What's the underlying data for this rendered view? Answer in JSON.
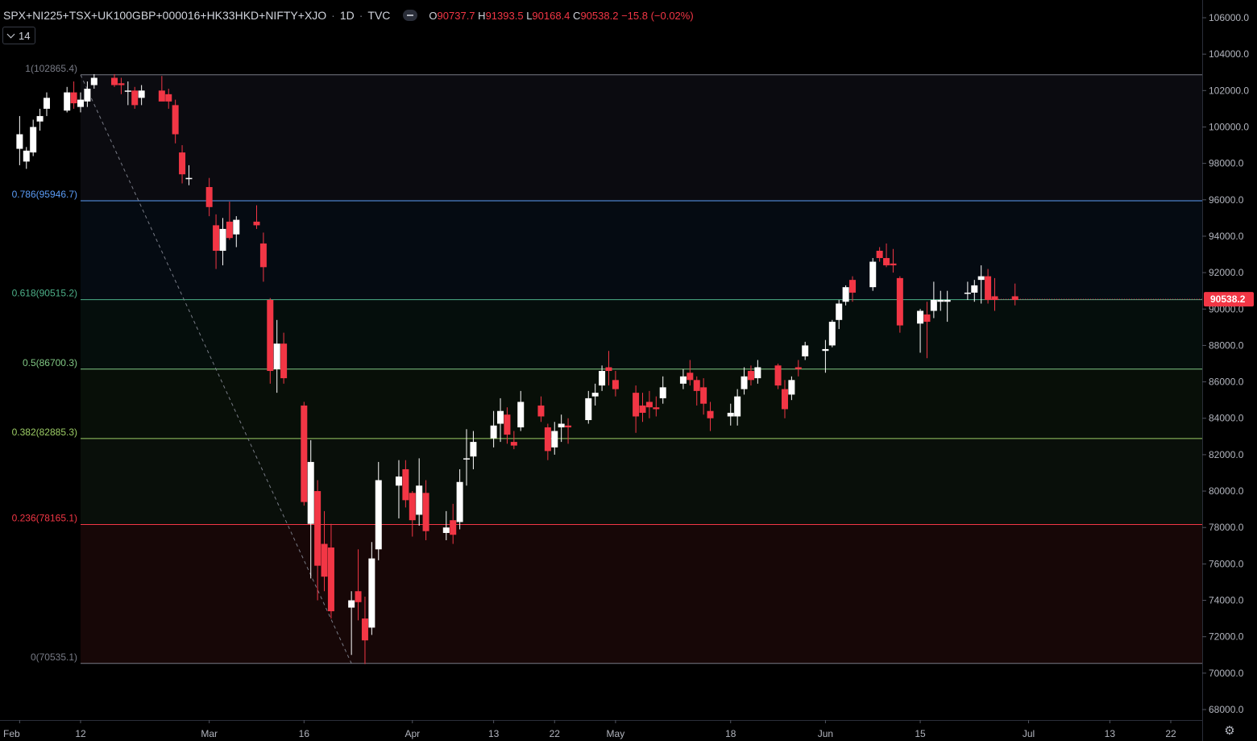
{
  "header": {
    "symbol": "SPX+NI225+TSX+UK100GBP+000016+HK33HKD+NIFTY+XJO",
    "interval": "1D",
    "source": "TVC",
    "o_label": "O",
    "o_value": "90737.7",
    "h_label": "H",
    "h_value": "91393.5",
    "l_label": "L",
    "l_value": "90168.4",
    "c_label": "C",
    "c_value": "90538.2",
    "change": "−15.8 (−0.02%)"
  },
  "indicator": {
    "value": "14"
  },
  "colors": {
    "background": "#000000",
    "up": "#ffffff",
    "down": "#f23645",
    "axis_text": "#b2b5be",
    "price_tag": "#f23645"
  },
  "icons": {
    "collapse": "chevron-down-icon",
    "hide": "minus-icon",
    "settings": "gear-icon"
  },
  "chart_data": {
    "type": "candlestick",
    "title": "SPX+NI225+TSX+UK100GBP+000016+HK33HKD+NIFTY+XJO · 1D · TVC",
    "ylim": [
      67500,
      107000
    ],
    "y_ticks": [
      106000,
      104000,
      102000,
      100000,
      98000,
      96000,
      94000,
      92000,
      90000,
      88000,
      86000,
      84000,
      82000,
      80000,
      78000,
      76000,
      74000,
      72000,
      70000,
      68000
    ],
    "y_tick_labels": [
      "106000.0",
      "104000.0",
      "102000.0",
      "100000.0",
      "98000.0",
      "96000.0",
      "94000.0",
      "92000.0",
      "90000.0",
      "88000.0",
      "86000.0",
      "84000.0",
      "82000.0",
      "80000.0",
      "78000.0",
      "76000.0",
      "74000.0",
      "72000.0",
      "70000.0",
      "68000.0"
    ],
    "x_ticks": [
      "2020-02-03",
      "2020-02-12",
      "2020-03-02",
      "2020-03-16",
      "2020-04-01",
      "2020-04-13",
      "2020-04-22",
      "2020-05-01",
      "2020-05-18",
      "2020-06-01",
      "2020-06-15",
      "2020-07-01",
      "2020-07-13",
      "2020-07-22"
    ],
    "x_tick_labels": [
      "Feb",
      "12",
      "Mar",
      "16",
      "Apr",
      "13",
      "22",
      "May",
      "18",
      "Jun",
      "15",
      "Jul",
      "13",
      "22"
    ],
    "last_price": 90538.2,
    "last_price_label": "90538.2",
    "fib": {
      "levels": [
        {
          "ratio": "1",
          "price": 102865.4,
          "label": "1(102865.4)",
          "color": "#787b86"
        },
        {
          "ratio": "0.786",
          "price": 95946.7,
          "label": "0.786(95946.7)",
          "color": "#5b9cf6"
        },
        {
          "ratio": "0.618",
          "price": 90515.2,
          "label": "0.618(90515.2)",
          "color": "#4caf88"
        },
        {
          "ratio": "0.5",
          "price": 86700.3,
          "label": "0.5(86700.3)",
          "color": "#81c784"
        },
        {
          "ratio": "0.382",
          "price": 82885.3,
          "label": "0.382(82885.3)",
          "color": "#9ccc65"
        },
        {
          "ratio": "0.236",
          "price": 78165.1,
          "label": "0.236(78165.1)",
          "color": "#f23645"
        },
        {
          "ratio": "0",
          "price": 70535.1,
          "label": "0(70535.1)",
          "color": "#787b86"
        }
      ],
      "fills": [
        "#0b0b10",
        "#050b12",
        "#050e0c",
        "#080f08",
        "#090f0a",
        "#170707"
      ],
      "trend_from": {
        "date": "2020-02-12",
        "price": 102865.4
      },
      "trend_to": {
        "date": "2020-03-23",
        "price": 70535.1
      }
    },
    "candles": [
      {
        "d": "2020-02-03",
        "o": 98800,
        "h": 100600,
        "l": 97900,
        "c": 99600
      },
      {
        "d": "2020-02-04",
        "o": 98100,
        "h": 98900,
        "l": 97700,
        "c": 98700
      },
      {
        "d": "2020-02-05",
        "o": 98600,
        "h": 100400,
        "l": 98400,
        "c": 100000
      },
      {
        "d": "2020-02-06",
        "o": 100300,
        "h": 101000,
        "l": 99800,
        "c": 100600
      },
      {
        "d": "2020-02-07",
        "o": 101000,
        "h": 101900,
        "l": 100600,
        "c": 101600
      },
      {
        "d": "2020-02-10",
        "o": 100900,
        "h": 102200,
        "l": 100800,
        "c": 101900
      },
      {
        "d": "2020-02-11",
        "o": 101900,
        "h": 102500,
        "l": 101000,
        "c": 101300
      },
      {
        "d": "2020-02-12",
        "o": 101100,
        "h": 101900,
        "l": 100800,
        "c": 101500
      },
      {
        "d": "2020-02-13",
        "o": 101400,
        "h": 102500,
        "l": 101100,
        "c": 102100
      },
      {
        "d": "2020-02-14",
        "o": 102300,
        "h": 102900,
        "l": 102100,
        "c": 102700
      },
      {
        "d": "2020-02-17",
        "o": 102700,
        "h": 102900,
        "l": 102200,
        "c": 102300
      },
      {
        "d": "2020-02-18",
        "o": 102400,
        "h": 102700,
        "l": 101800,
        "c": 102300
      },
      {
        "d": "2020-02-19",
        "o": 102000,
        "h": 102500,
        "l": 101200,
        "c": 102000
      },
      {
        "d": "2020-02-20",
        "o": 102000,
        "h": 102200,
        "l": 101000,
        "c": 101200
      },
      {
        "d": "2020-02-21",
        "o": 101600,
        "h": 102300,
        "l": 101200,
        "c": 102000
      },
      {
        "d": "2020-02-24",
        "o": 102000,
        "h": 102800,
        "l": 101500,
        "c": 101400
      },
      {
        "d": "2020-02-25",
        "o": 101800,
        "h": 102100,
        "l": 101000,
        "c": 101400
      },
      {
        "d": "2020-02-26",
        "o": 101200,
        "h": 101500,
        "l": 99100,
        "c": 99600
      },
      {
        "d": "2020-02-27",
        "o": 98600,
        "h": 99000,
        "l": 96900,
        "c": 97400
      },
      {
        "d": "2020-02-28",
        "o": 97200,
        "h": 97900,
        "l": 96800,
        "c": 97200
      },
      {
        "d": "2020-03-02",
        "o": 96700,
        "h": 97200,
        "l": 95100,
        "c": 95600
      },
      {
        "d": "2020-03-03",
        "o": 94600,
        "h": 95200,
        "l": 92200,
        "c": 93200
      },
      {
        "d": "2020-03-04",
        "o": 93200,
        "h": 95000,
        "l": 92400,
        "c": 94400
      },
      {
        "d": "2020-03-05",
        "o": 94800,
        "h": 95900,
        "l": 93800,
        "c": 93900
      },
      {
        "d": "2020-03-06",
        "o": 94100,
        "h": 95100,
        "l": 93400,
        "c": 94900
      },
      {
        "d": "2020-03-09",
        "o": 94800,
        "h": 95700,
        "l": 94400,
        "c": 94600
      },
      {
        "d": "2020-03-10",
        "o": 93600,
        "h": 94200,
        "l": 91500,
        "c": 92300
      },
      {
        "d": "2020-03-11",
        "o": 90500,
        "h": 90600,
        "l": 85900,
        "c": 86600
      },
      {
        "d": "2020-03-12",
        "o": 86700,
        "h": 89400,
        "l": 85400,
        "c": 88100
      },
      {
        "d": "2020-03-13",
        "o": 88100,
        "h": 88700,
        "l": 85900,
        "c": 86200
      },
      {
        "d": "2020-03-16",
        "o": 84700,
        "h": 84900,
        "l": 79200,
        "c": 79400
      },
      {
        "d": "2020-03-17",
        "o": 78200,
        "h": 82800,
        "l": 75200,
        "c": 81600
      },
      {
        "d": "2020-03-18",
        "o": 80000,
        "h": 80600,
        "l": 74000,
        "c": 75900
      },
      {
        "d": "2020-03-19",
        "o": 77100,
        "h": 78900,
        "l": 74500,
        "c": 75300
      },
      {
        "d": "2020-03-20",
        "o": 76900,
        "h": 78200,
        "l": 73000,
        "c": 73400
      },
      {
        "d": "2020-03-23",
        "o": 73600,
        "h": 74500,
        "l": 71000,
        "c": 74000
      },
      {
        "d": "2020-03-24",
        "o": 74500,
        "h": 76800,
        "l": 72900,
        "c": 73900
      },
      {
        "d": "2020-03-25",
        "o": 73000,
        "h": 74200,
        "l": 70500,
        "c": 71800
      },
      {
        "d": "2020-03-26",
        "o": 72500,
        "h": 77200,
        "l": 72100,
        "c": 76300
      },
      {
        "d": "2020-03-27",
        "o": 76800,
        "h": 81600,
        "l": 76200,
        "c": 80600
      },
      {
        "d": "2020-03-30",
        "o": 80300,
        "h": 81700,
        "l": 78500,
        "c": 80800
      },
      {
        "d": "2020-03-31",
        "o": 81200,
        "h": 81700,
        "l": 79100,
        "c": 79500
      },
      {
        "d": "2020-04-01",
        "o": 79900,
        "h": 80000,
        "l": 77500,
        "c": 78400
      },
      {
        "d": "2020-04-02",
        "o": 78700,
        "h": 81800,
        "l": 78100,
        "c": 80300
      },
      {
        "d": "2020-04-03",
        "o": 79900,
        "h": 80600,
        "l": 77300,
        "c": 77800
      },
      {
        "d": "2020-04-06",
        "o": 77700,
        "h": 78900,
        "l": 77300,
        "c": 78000
      },
      {
        "d": "2020-04-07",
        "o": 78400,
        "h": 79300,
        "l": 77100,
        "c": 77600
      },
      {
        "d": "2020-04-08",
        "o": 78300,
        "h": 81200,
        "l": 77900,
        "c": 80500
      },
      {
        "d": "2020-04-09",
        "o": 81800,
        "h": 83400,
        "l": 80300,
        "c": 81800
      },
      {
        "d": "2020-04-10",
        "o": 81900,
        "h": 83300,
        "l": 81200,
        "c": 82700
      },
      {
        "d": "2020-04-13",
        "o": 82900,
        "h": 84400,
        "l": 82400,
        "c": 83600
      },
      {
        "d": "2020-04-14",
        "o": 83700,
        "h": 85100,
        "l": 82700,
        "c": 84400
      },
      {
        "d": "2020-04-15",
        "o": 84200,
        "h": 84600,
        "l": 82600,
        "c": 83100
      },
      {
        "d": "2020-04-16",
        "o": 82700,
        "h": 83300,
        "l": 82300,
        "c": 82500
      },
      {
        "d": "2020-04-17",
        "o": 83500,
        "h": 85500,
        "l": 83300,
        "c": 84900
      },
      {
        "d": "2020-04-20",
        "o": 84700,
        "h": 85200,
        "l": 83800,
        "c": 84100
      },
      {
        "d": "2020-04-21",
        "o": 83500,
        "h": 83700,
        "l": 81700,
        "c": 82200
      },
      {
        "d": "2020-04-22",
        "o": 82400,
        "h": 83800,
        "l": 82000,
        "c": 83300
      },
      {
        "d": "2020-04-23",
        "o": 83500,
        "h": 84200,
        "l": 82700,
        "c": 83700
      },
      {
        "d": "2020-04-24",
        "o": 83600,
        "h": 84000,
        "l": 82600,
        "c": 83500
      },
      {
        "d": "2020-04-27",
        "o": 83900,
        "h": 85500,
        "l": 83700,
        "c": 85100
      },
      {
        "d": "2020-04-28",
        "o": 85200,
        "h": 85900,
        "l": 84700,
        "c": 85400
      },
      {
        "d": "2020-04-29",
        "o": 85800,
        "h": 86900,
        "l": 85500,
        "c": 86600
      },
      {
        "d": "2020-04-30",
        "o": 86800,
        "h": 87700,
        "l": 85800,
        "c": 86600
      },
      {
        "d": "2020-05-01",
        "o": 86100,
        "h": 86600,
        "l": 85200,
        "c": 85600
      },
      {
        "d": "2020-05-04",
        "o": 85400,
        "h": 85800,
        "l": 83200,
        "c": 84100
      },
      {
        "d": "2020-05-05",
        "o": 84700,
        "h": 85400,
        "l": 83800,
        "c": 84300
      },
      {
        "d": "2020-05-06",
        "o": 84900,
        "h": 85500,
        "l": 84000,
        "c": 84600
      },
      {
        "d": "2020-05-07",
        "o": 84600,
        "h": 85200,
        "l": 84100,
        "c": 84500
      },
      {
        "d": "2020-05-08",
        "o": 85100,
        "h": 86300,
        "l": 84800,
        "c": 85700
      },
      {
        "d": "2020-05-11",
        "o": 85900,
        "h": 86700,
        "l": 85600,
        "c": 86300
      },
      {
        "d": "2020-05-12",
        "o": 86500,
        "h": 87200,
        "l": 85800,
        "c": 86100
      },
      {
        "d": "2020-05-13",
        "o": 86100,
        "h": 86300,
        "l": 84700,
        "c": 85500
      },
      {
        "d": "2020-05-14",
        "o": 85700,
        "h": 86200,
        "l": 84200,
        "c": 84800
      },
      {
        "d": "2020-05-15",
        "o": 84400,
        "h": 84900,
        "l": 83300,
        "c": 84000
      },
      {
        "d": "2020-05-18",
        "o": 84100,
        "h": 84800,
        "l": 83600,
        "c": 84300
      },
      {
        "d": "2020-05-19",
        "o": 84100,
        "h": 85600,
        "l": 83600,
        "c": 85200
      },
      {
        "d": "2020-05-20",
        "o": 85600,
        "h": 86800,
        "l": 85300,
        "c": 86300
      },
      {
        "d": "2020-05-21",
        "o": 86600,
        "h": 86900,
        "l": 85800,
        "c": 86100
      },
      {
        "d": "2020-05-22",
        "o": 86200,
        "h": 87200,
        "l": 85900,
        "c": 86800
      },
      {
        "d": "2020-05-25",
        "o": 86900,
        "h": 87000,
        "l": 85600,
        "c": 85800
      },
      {
        "d": "2020-05-26",
        "o": 85600,
        "h": 86100,
        "l": 84000,
        "c": 84500
      },
      {
        "d": "2020-05-27",
        "o": 85300,
        "h": 86300,
        "l": 85000,
        "c": 86100
      },
      {
        "d": "2020-05-28",
        "o": 86800,
        "h": 87200,
        "l": 86300,
        "c": 86700
      },
      {
        "d": "2020-05-29",
        "o": 87400,
        "h": 88200,
        "l": 87200,
        "c": 88000
      },
      {
        "d": "2020-06-01",
        "o": 87700,
        "h": 88300,
        "l": 86500,
        "c": 87800
      },
      {
        "d": "2020-06-02",
        "o": 88000,
        "h": 89400,
        "l": 87900,
        "c": 89300
      },
      {
        "d": "2020-06-03",
        "o": 89400,
        "h": 90500,
        "l": 88900,
        "c": 90300
      },
      {
        "d": "2020-06-04",
        "o": 90400,
        "h": 91300,
        "l": 90200,
        "c": 91200
      },
      {
        "d": "2020-06-05",
        "o": 91600,
        "h": 91800,
        "l": 90400,
        "c": 90900
      },
      {
        "d": "2020-06-08",
        "o": 91200,
        "h": 92800,
        "l": 91000,
        "c": 92600
      },
      {
        "d": "2020-06-09",
        "o": 93200,
        "h": 93400,
        "l": 92600,
        "c": 92800
      },
      {
        "d": "2020-06-10",
        "o": 92800,
        "h": 93600,
        "l": 92300,
        "c": 92400
      },
      {
        "d": "2020-06-11",
        "o": 92500,
        "h": 93300,
        "l": 92000,
        "c": 92400
      },
      {
        "d": "2020-06-12",
        "o": 91700,
        "h": 91800,
        "l": 88700,
        "c": 89100
      },
      {
        "d": "2020-06-15",
        "o": 89200,
        "h": 90000,
        "l": 87600,
        "c": 89900
      },
      {
        "d": "2020-06-16",
        "o": 89700,
        "h": 90400,
        "l": 87300,
        "c": 89300
      },
      {
        "d": "2020-06-17",
        "o": 89900,
        "h": 91500,
        "l": 89500,
        "c": 90500
      },
      {
        "d": "2020-06-18",
        "o": 90400,
        "h": 91000,
        "l": 89900,
        "c": 90500
      },
      {
        "d": "2020-06-19",
        "o": 90400,
        "h": 91000,
        "l": 89300,
        "c": 90500
      },
      {
        "d": "2020-06-22",
        "o": 90900,
        "h": 91500,
        "l": 90500,
        "c": 90900
      },
      {
        "d": "2020-06-23",
        "o": 90900,
        "h": 91600,
        "l": 90400,
        "c": 91300
      },
      {
        "d": "2020-06-24",
        "o": 91600,
        "h": 92400,
        "l": 90300,
        "c": 91800
      },
      {
        "d": "2020-06-25",
        "o": 91800,
        "h": 92200,
        "l": 90300,
        "c": 90500
      },
      {
        "d": "2020-06-26",
        "o": 90700,
        "h": 91700,
        "l": 89900,
        "c": 90500
      },
      {
        "d": "2020-06-29",
        "o": 90700,
        "h": 91400,
        "l": 90200,
        "c": 90500
      }
    ]
  }
}
